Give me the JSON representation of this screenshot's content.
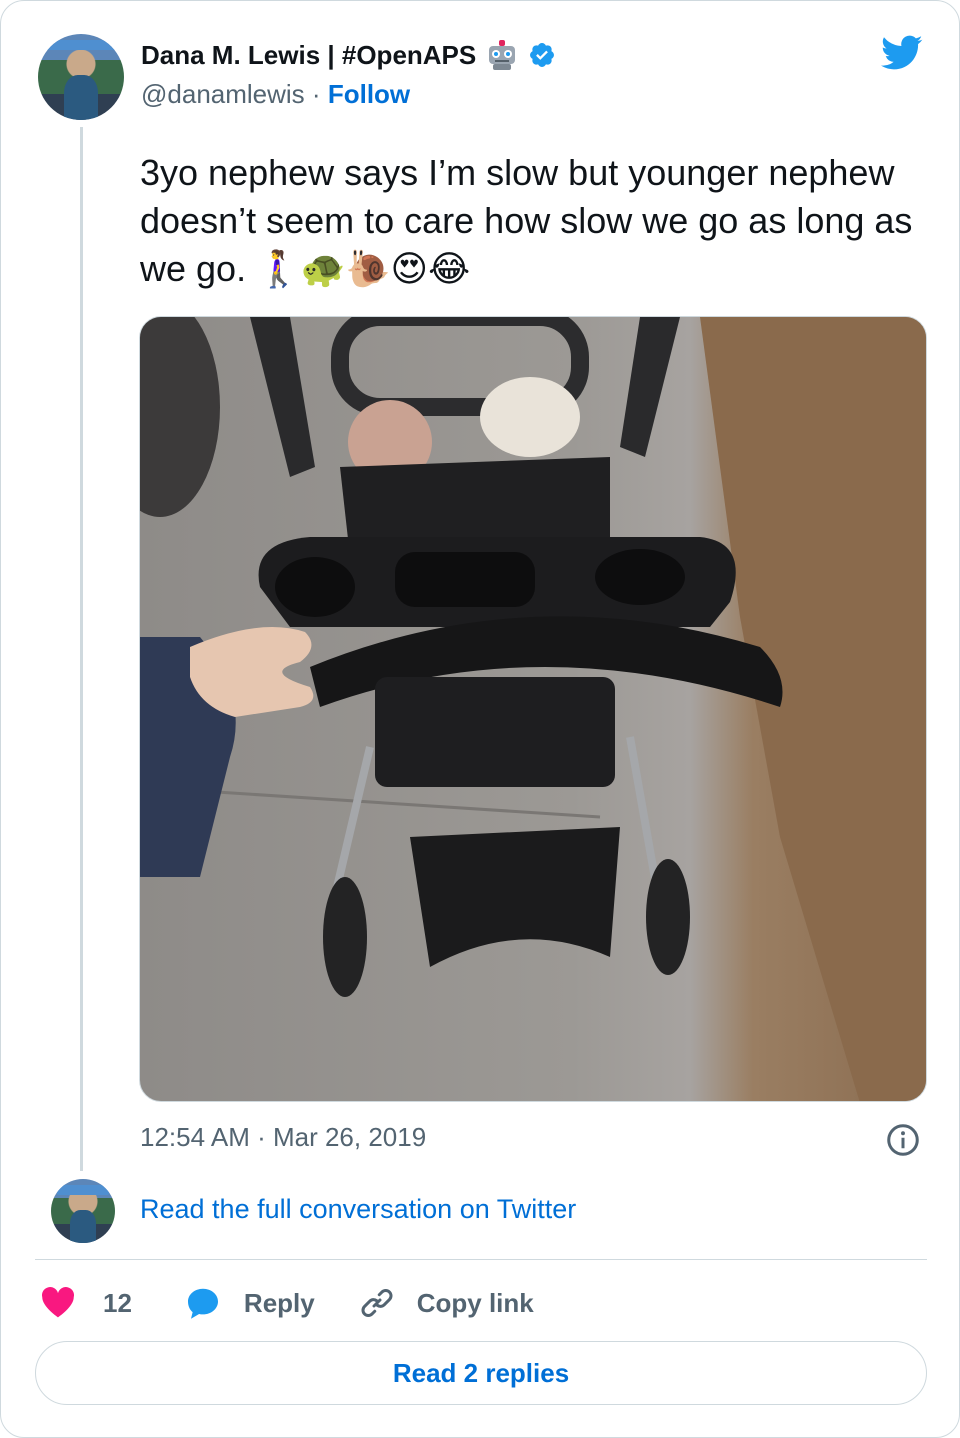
{
  "author": {
    "display_name": "Dana M. Lewis | #OpenAPS",
    "handle": "@danamlewis",
    "separator": "·",
    "follow_label": "Follow",
    "badge_icon": "robot-icon",
    "verified_icon": "verified-badge-icon"
  },
  "tweet": {
    "text": "3yo nephew says I’m slow but younger nephew doesn’t seem to care how slow we go as long as we go. 🚶‍♀️🐢🐌😍😂",
    "timestamp": "12:54 AM · Mar 26, 2019",
    "photo_alt": "stroller-photo"
  },
  "conversation": {
    "read_full_label": "Read the full conversation on Twitter"
  },
  "actions": {
    "like_count": "12",
    "reply_label": "Reply",
    "copy_label": "Copy link"
  },
  "footer": {
    "read_replies_label": "Read 2 replies"
  },
  "colors": {
    "brand_blue": "#1d9bf0",
    "link_blue": "#006fd6",
    "like_pink": "#f91880",
    "muted": "#536471",
    "border": "#cfd9de"
  }
}
